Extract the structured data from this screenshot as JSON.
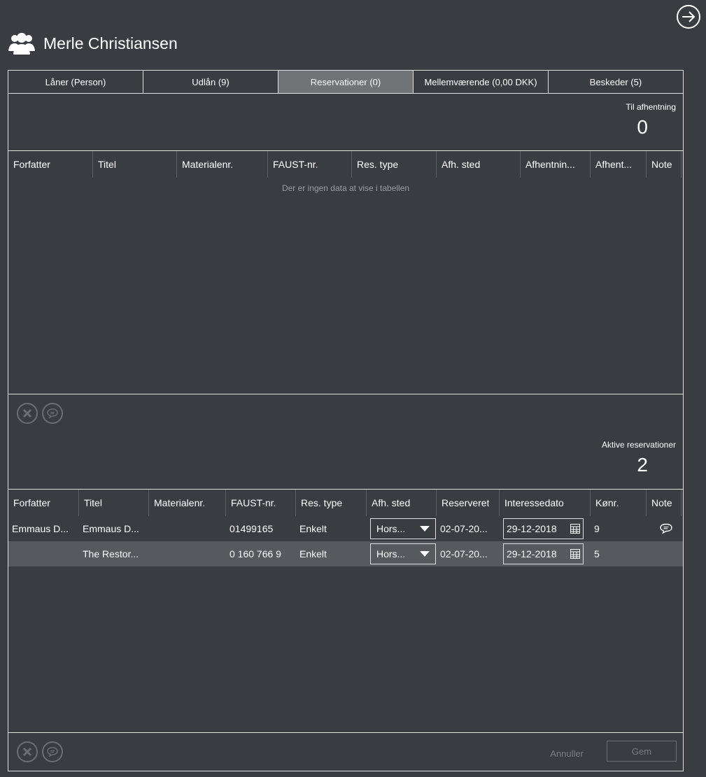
{
  "window": {
    "user_name": "Merle Christiansen"
  },
  "tabs": [
    {
      "label": "Låner (Person)"
    },
    {
      "label": "Udlån (9)"
    },
    {
      "label": "Reservationer (0)"
    },
    {
      "label": "Mellemværende (0,00 DKK)"
    },
    {
      "label": "Beskeder (5)"
    }
  ],
  "pickup": {
    "label": "Til afhentning",
    "count": "0",
    "columns": [
      "Forfatter",
      "Titel",
      "Materialenr.",
      "FAUST-nr.",
      "Res. type",
      "Afh. sted",
      "Afhentnin...",
      "Afhent...",
      "Note"
    ],
    "empty_message": "Der er ingen data at vise i tabellen"
  },
  "active": {
    "label": "Aktive reservationer",
    "count": "2",
    "columns": [
      "Forfatter",
      "Titel",
      "Materialenr.",
      "FAUST-nr.",
      "Res. type",
      "Afh. sted",
      "Reserveret",
      "Interessedato",
      "Kønr.",
      "Note"
    ],
    "rows": [
      {
        "author": "Emmaus D...",
        "title": "Emmaus D...",
        "material": "",
        "faust": "01499165",
        "res_type": "Enkelt",
        "pickup_place": "Hors...",
        "reserved": "02-07-20...",
        "interest_date": "29-12-2018",
        "queue": "9",
        "has_note": true
      },
      {
        "author": "",
        "title": "The Restor...",
        "material": "",
        "faust": "0 160 766 9",
        "res_type": "Enkelt",
        "pickup_place": "Hors...",
        "reserved": "02-07-20...",
        "interest_date": "29-12-2018",
        "queue": "5",
        "has_note": false
      }
    ]
  },
  "footer": {
    "cancel_label": "Annuller",
    "save_label": "Gem"
  },
  "colors": {
    "background": "#393d41",
    "active_tab": "#717477",
    "alt_row": "#565a5e",
    "border": "#e0e0e0"
  }
}
